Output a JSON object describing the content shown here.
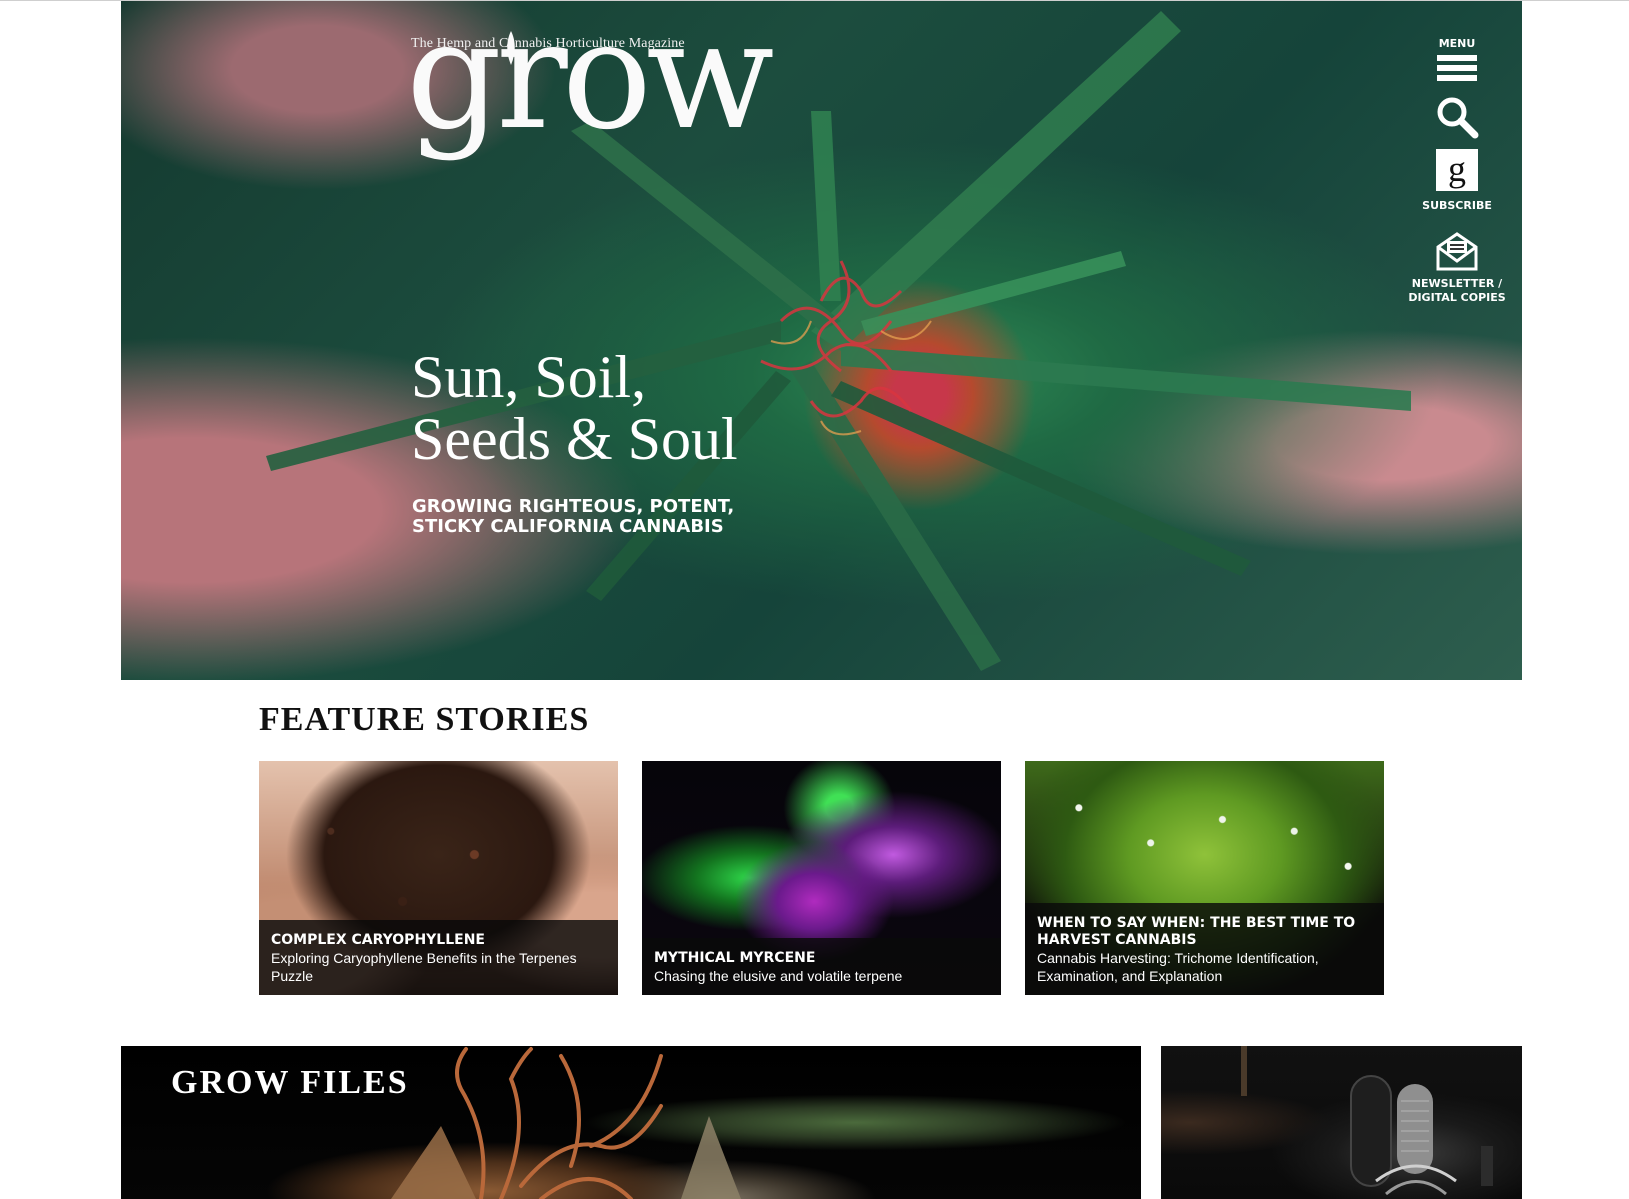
{
  "hero": {
    "tagline": "The Hemp and Cannabis Horticulture Magazine",
    "logo": "grow",
    "headline_line1": "Sun, Soil,",
    "headline_line2": "Seeds & Soul",
    "subhead_line1": "GROWING RIGHTEOUS, POTENT,",
    "subhead_line2": "STICKY CALIFORNIA CANNABIS"
  },
  "nav": {
    "menu_label": "MENU",
    "search_icon": "search-icon",
    "subscribe_glyph": "g",
    "subscribe_label": "SUBSCRIBE",
    "newsletter_line1": "NEWSLETTER /",
    "newsletter_line2": "DIGITAL COPIES"
  },
  "features": {
    "title": "FEATURE STORIES",
    "cards": [
      {
        "title": "COMPLEX CARYOPHYLLENE",
        "subtitle": "Exploring Caryophyllene Benefits in the Terpenes Puzzle",
        "image": "cloves-in-hands"
      },
      {
        "title": "MYTHICAL MYRCENE",
        "subtitle": "Chasing the elusive and volatile terpene",
        "image": "neon-cannabis-bud"
      },
      {
        "title": "WHEN TO SAY WHEN: THE BEST TIME TO HARVEST CANNABIS",
        "subtitle": "Cannabis Harvesting: Trichome Identification, Examination, and Explanation",
        "image": "trichomes-macro"
      }
    ]
  },
  "grow_files": {
    "title": "GROW FILES"
  },
  "colors": {
    "overlay": "#0a0a0a",
    "text_light": "#ffffff",
    "heading_dark": "#111111"
  }
}
